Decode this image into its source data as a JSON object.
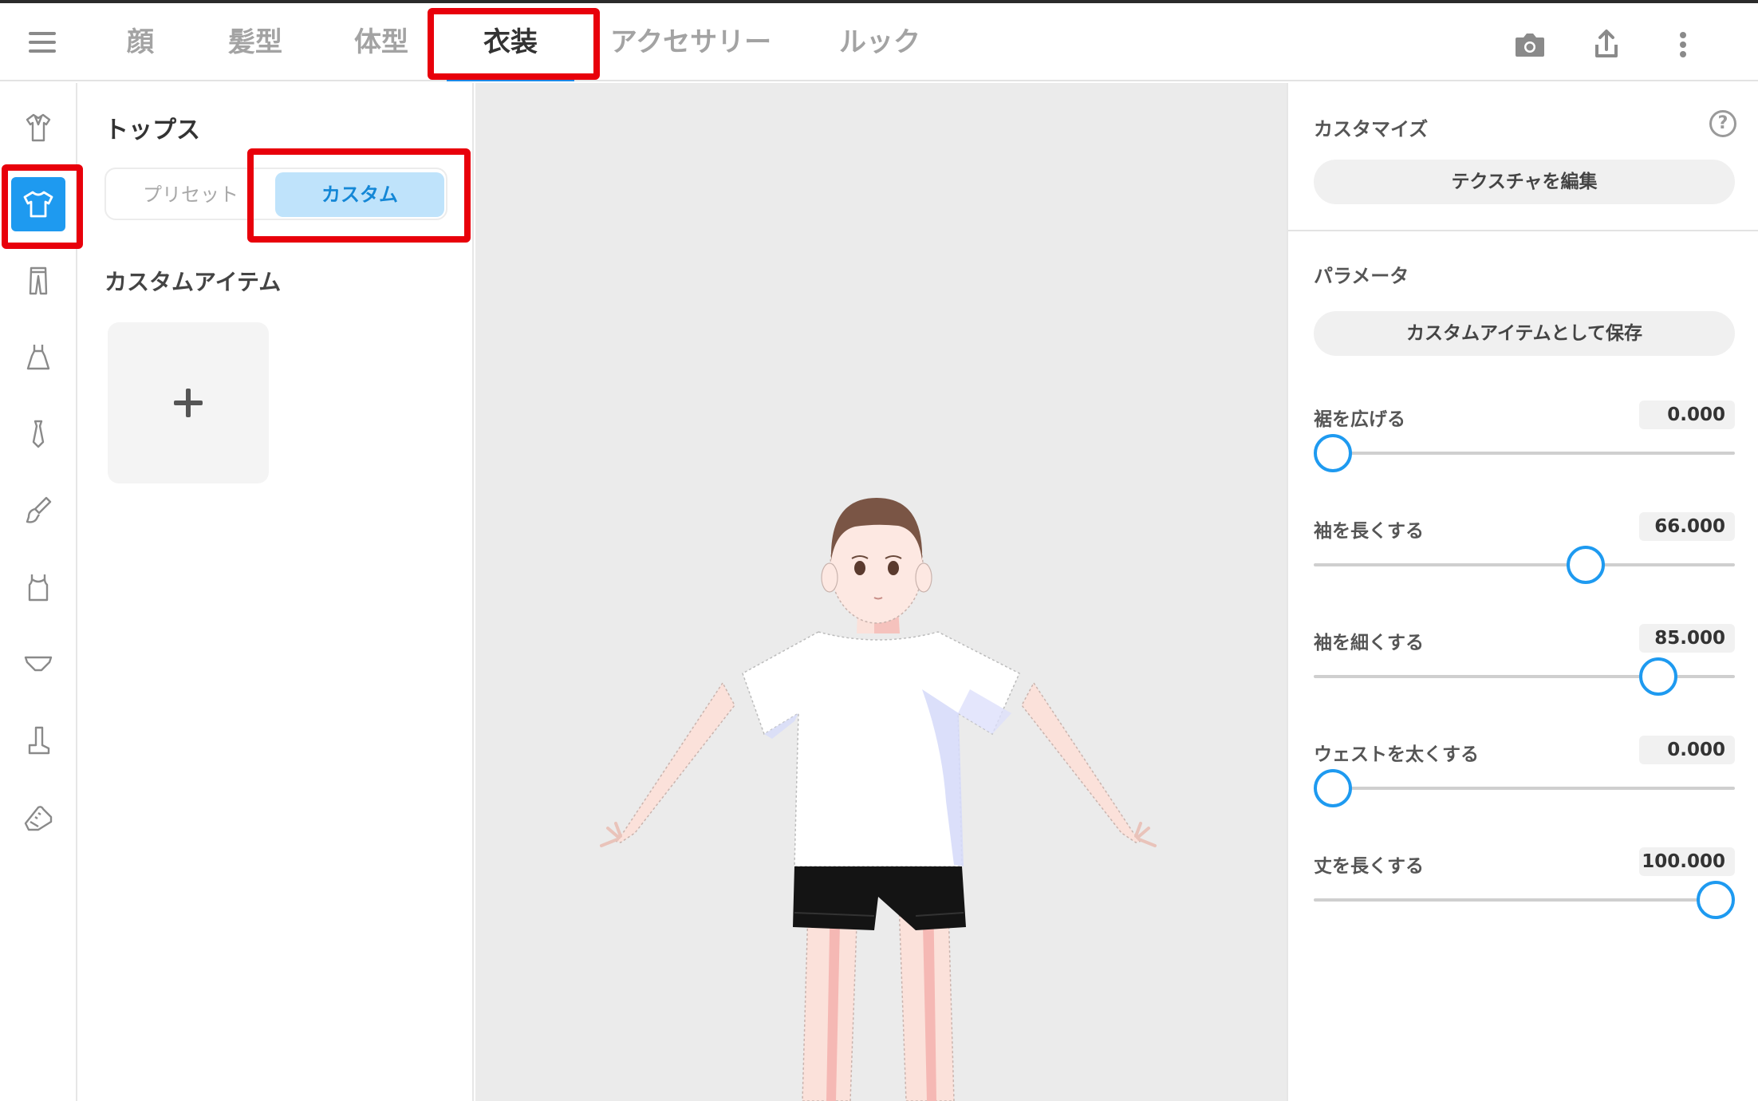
{
  "header": {
    "menu_icon": "hamburger-menu-icon",
    "tabs": [
      {
        "label": "顔"
      },
      {
        "label": "髪型"
      },
      {
        "label": "体型"
      },
      {
        "label": "衣装"
      },
      {
        "label": "アクセサリー"
      },
      {
        "label": "ルック"
      }
    ],
    "active_tab": "衣装",
    "actions": [
      "camera-icon",
      "share-upload-icon",
      "more-vertical-icon"
    ]
  },
  "rail": {
    "items": [
      {
        "icon": "shirt-outline-icon"
      },
      {
        "icon": "tshirt-icon",
        "active": true
      },
      {
        "icon": "pants-icon"
      },
      {
        "icon": "dress-icon"
      },
      {
        "icon": "necktie-icon"
      },
      {
        "icon": "paintbrush-icon"
      },
      {
        "icon": "tank-top-icon"
      },
      {
        "icon": "underwear-icon"
      },
      {
        "icon": "boot-icon"
      },
      {
        "icon": "sneaker-icon"
      }
    ],
    "active_color": "#1e9af0"
  },
  "panel": {
    "title": "トップス",
    "segment": {
      "preset": "プリセット",
      "custom": "カスタム",
      "selected": "カスタム"
    },
    "section_title": "カスタムアイテム",
    "add_icon": "plus-icon"
  },
  "right_panel": {
    "customize_heading": "カスタマイズ",
    "help_icon": "?",
    "edit_texture_button": "テクスチャを編集",
    "parameters_heading": "パラメータ",
    "save_button": "カスタムアイテムとして保存",
    "params": [
      {
        "label": "裾を広げる",
        "value": "0.000",
        "fraction": 0.0
      },
      {
        "label": "袖を長くする",
        "value": "66.000",
        "fraction": 0.66
      },
      {
        "label": "袖を細くする",
        "value": "85.000",
        "fraction": 0.85
      },
      {
        "label": "ウェストを太くする",
        "value": "0.000",
        "fraction": 0.0
      },
      {
        "label": "丈を長くする",
        "value": "100.000",
        "fraction": 1.0
      }
    ],
    "slider_color": "#1e9af0"
  },
  "annotations": {
    "highlight_color": "#e8000b"
  }
}
